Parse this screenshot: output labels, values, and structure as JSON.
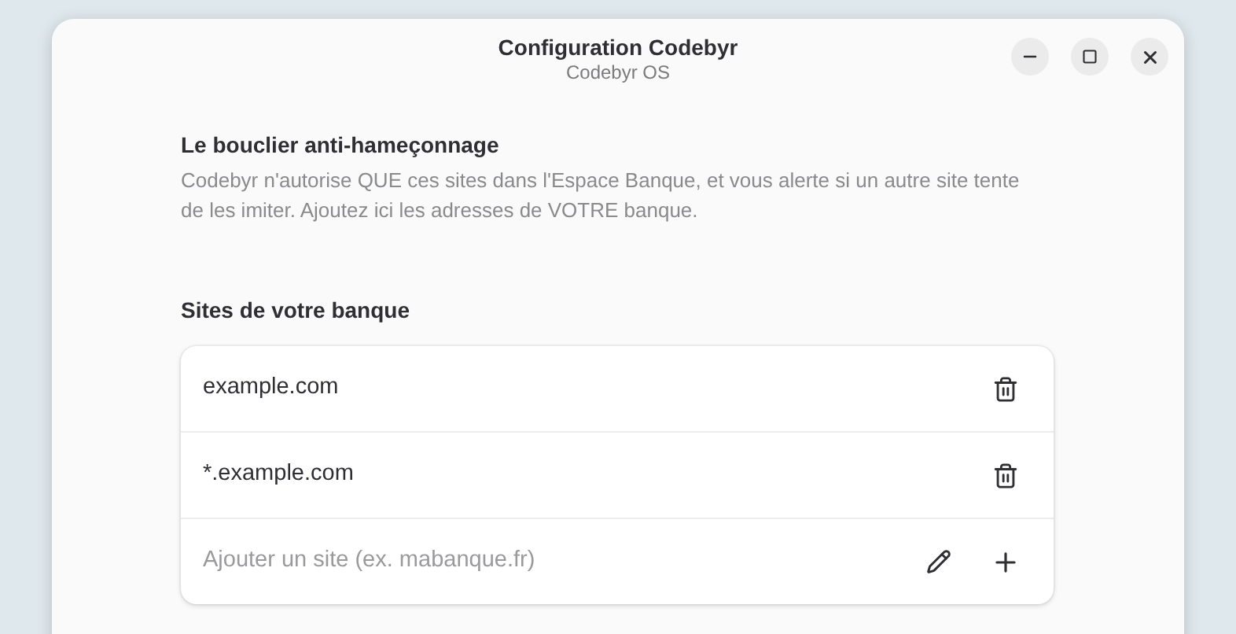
{
  "window": {
    "title": "Configuration Codebyr",
    "subtitle": "Codebyr OS"
  },
  "intro": {
    "heading": "Le bouclier anti-hameçonnage",
    "description": "Codebyr n'autorise QUE ces sites dans l'Espace Banque, et vous alerte si un autre site tente de les imiter. Ajoutez ici les adresses de VOTRE banque."
  },
  "sites": {
    "heading": "Sites de votre banque",
    "items": [
      {
        "label": "example.com"
      },
      {
        "label": "*.example.com"
      }
    ],
    "add_field": {
      "placeholder": "Ajouter un site (ex. mabanque.fr)"
    }
  }
}
